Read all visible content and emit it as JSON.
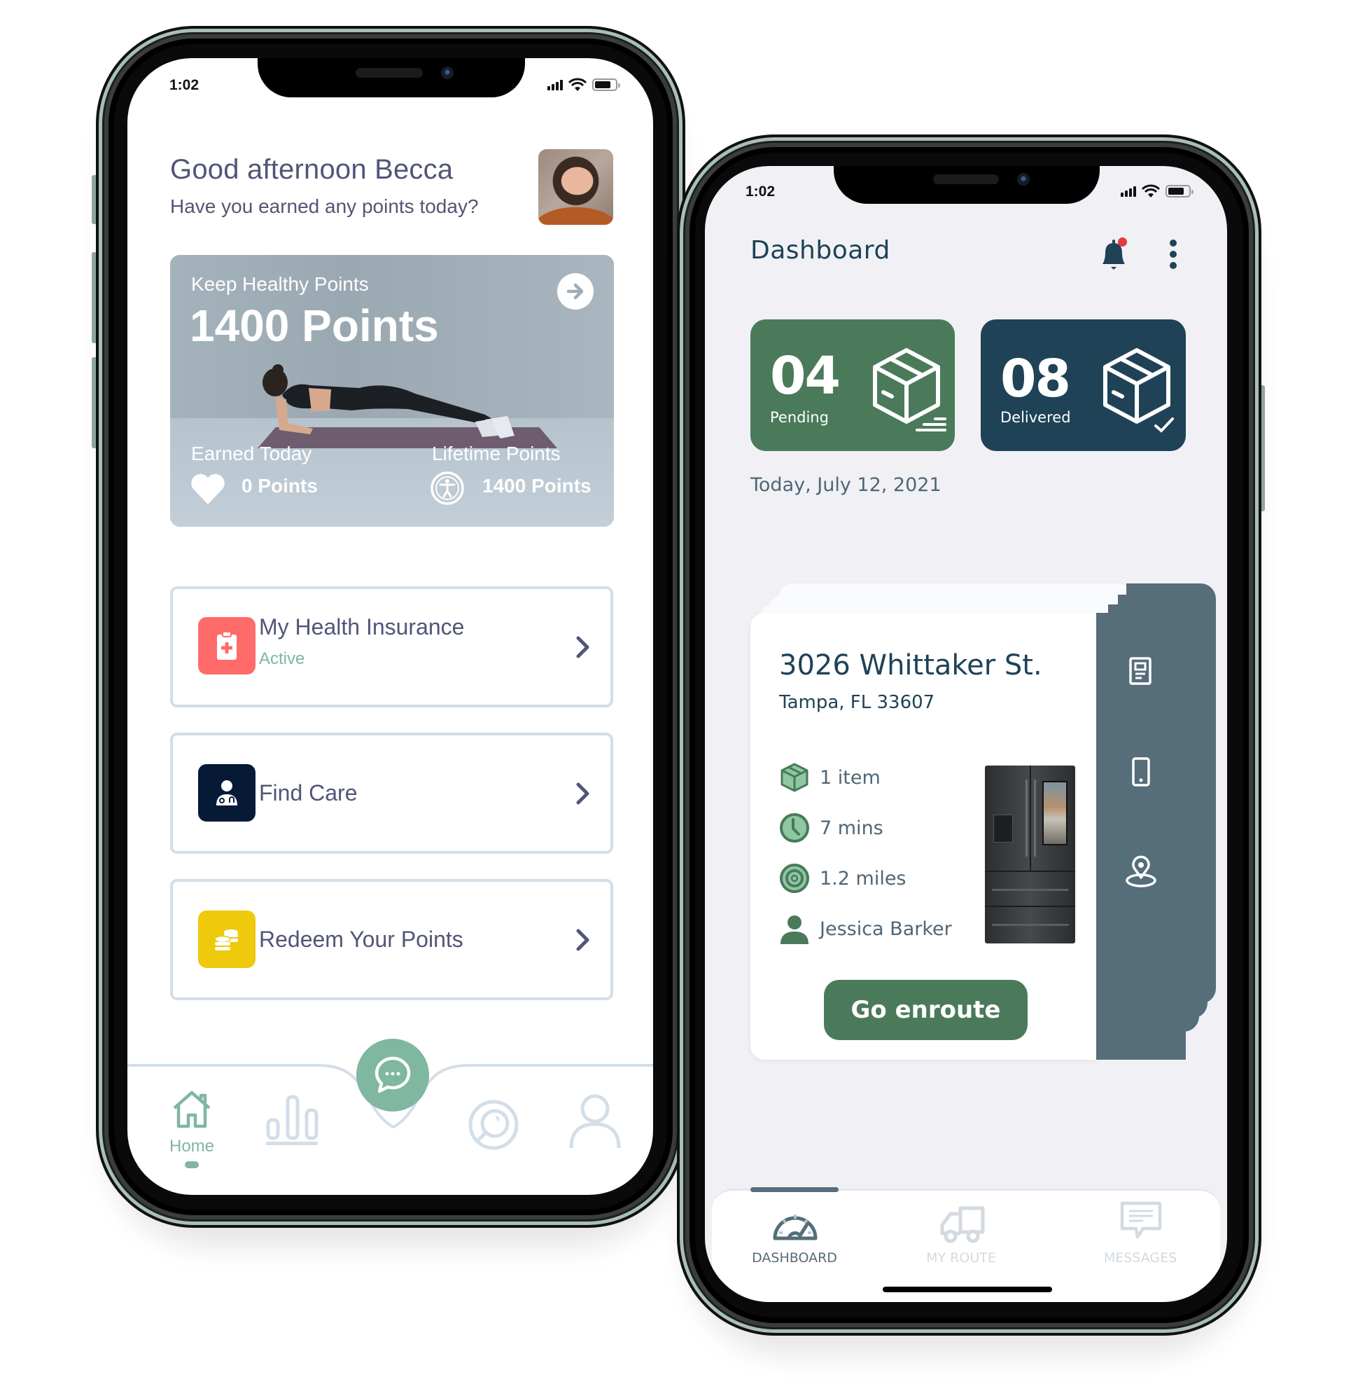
{
  "left_phone": {
    "status": {
      "time": "1:02"
    },
    "greeting": {
      "title": "Good afternoon Becca",
      "subtitle": "Have you earned any points today?"
    },
    "points_card": {
      "label": "Keep Healthy Points",
      "total": "1400 Points",
      "earned_label": "Earned Today",
      "earned_value": "0 Points",
      "lifetime_label": "Lifetime Points",
      "lifetime_value": "1400 Points"
    },
    "menu": [
      {
        "label": "My Health Insurance",
        "sublabel": "Active",
        "icon": "clipboard-medical-icon",
        "color": "#ff6b6b"
      },
      {
        "label": "Find Care",
        "sublabel": "",
        "icon": "doctor-icon",
        "color": "#061a36"
      },
      {
        "label": "Redeem Your Points",
        "sublabel": "",
        "icon": "coins-icon",
        "color": "#efc90c"
      }
    ],
    "nav": {
      "items": [
        {
          "label": "Home",
          "icon": "home-icon",
          "active": true
        },
        {
          "label": "",
          "icon": "bar-chart-icon",
          "active": false
        },
        {
          "label": "",
          "icon": "chat-icon",
          "active": false
        },
        {
          "label": "",
          "icon": "search-icon",
          "active": false
        },
        {
          "label": "",
          "icon": "profile-icon",
          "active": false
        }
      ]
    },
    "colors": {
      "accent": "#7fb7a0",
      "text": "#525577",
      "border": "#d3dee8"
    }
  },
  "right_phone": {
    "status": {
      "time": "1:02"
    },
    "header": {
      "title": "Dashboard",
      "has_notification": true
    },
    "stats": [
      {
        "value": "04",
        "label": "Pending",
        "color": "#4a7a5a"
      },
      {
        "value": "08",
        "label": "Delivered",
        "color": "#1f4257"
      }
    ],
    "date": "Today, July 12, 2021",
    "delivery": {
      "address": "3026 Whittaker St.",
      "city": "Tampa, FL 33607",
      "items": "1 item",
      "time": "7 mins",
      "distance": "1.2 miles",
      "customer": "Jessica Barker",
      "button": "Go enroute"
    },
    "nav": {
      "items": [
        {
          "label": "DASHBOARD",
          "icon": "dashboard-gauge-icon",
          "active": true
        },
        {
          "label": "MY ROUTE",
          "icon": "truck-icon",
          "active": false
        },
        {
          "label": "MESSAGES",
          "icon": "message-icon",
          "active": false
        }
      ]
    },
    "colors": {
      "green": "#4a7a5a",
      "navy": "#1f4257",
      "panel": "#566d7a",
      "background": "#f1f1f5"
    }
  }
}
